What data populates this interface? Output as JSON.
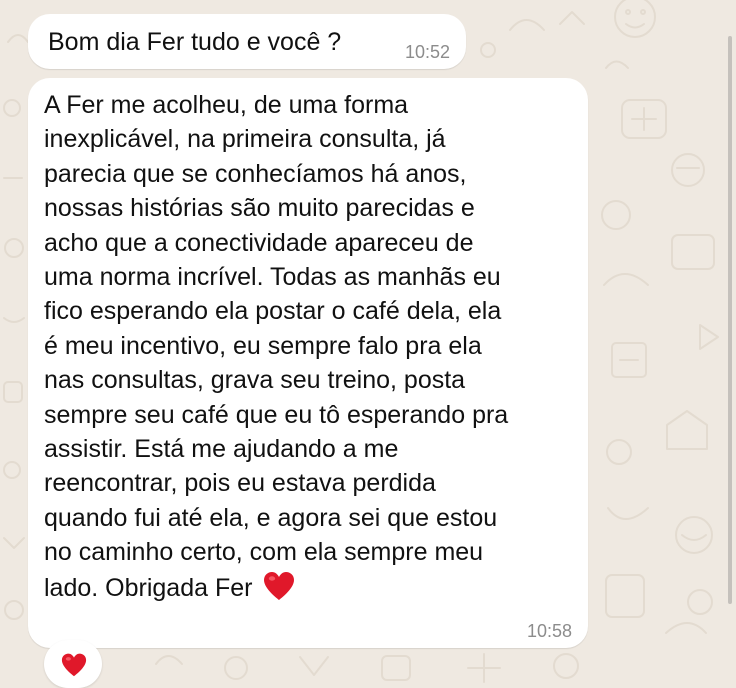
{
  "conversation": {
    "messages": [
      {
        "lines": [
          "Bom dia Fer tudo e você ?"
        ],
        "time": "10:52"
      },
      {
        "lines": [
          "A Fer me acolheu, de uma forma",
          "inexplicável, na primeira consulta, já",
          "parecia que se conhecíamos há anos,",
          "nossas histórias são muito parecidas e",
          "acho que a conectividade apareceu de",
          "uma norma incrível. Todas as manhãs eu",
          "fico esperando ela postar o café dela, ela",
          "é meu incentivo, eu sempre falo pra ela",
          "nas consultas, grava seu treino, posta",
          "sempre seu café que eu tô esperando pra",
          "assistir. Está me ajudando a me",
          "reencontrar, pois eu estava perdida",
          "quando fui até ela, e agora sei que estou",
          "no caminho certo, com ela sempre meu",
          "lado. Obrigada Fer"
        ],
        "emoji": "red-heart-icon",
        "time": "10:58",
        "reaction": "red-heart-icon"
      }
    ]
  },
  "colors": {
    "background": "#efe9e1",
    "bubble": "#ffffff",
    "text": "#111111",
    "timestamp": "#8c8c8c",
    "heart": "#e0182a"
  }
}
